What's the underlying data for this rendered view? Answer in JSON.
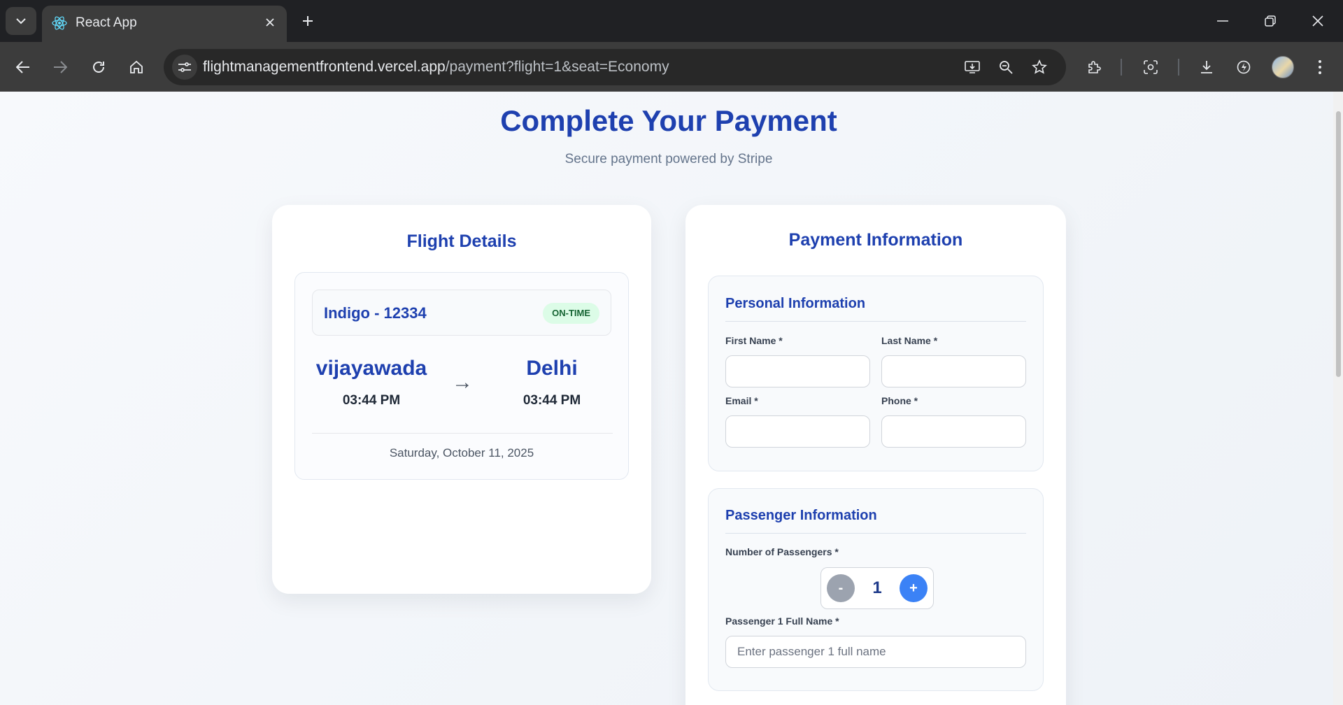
{
  "browser": {
    "tab_title": "React App",
    "url_host": "flightmanagementfrontend.vercel.app",
    "url_path": "/payment?flight=1&seat=Economy"
  },
  "page": {
    "title": "Complete Your Payment",
    "subtitle": "Secure payment powered by Stripe"
  },
  "flight_details": {
    "heading": "Flight Details",
    "airline": "Indigo - 12334",
    "status": "ON-TIME",
    "origin": {
      "city": "vijayawada",
      "time": "03:44 PM"
    },
    "destination": {
      "city": "Delhi",
      "time": "03:44 PM"
    },
    "arrow": "→",
    "date": "Saturday, October 11, 2025"
  },
  "payment": {
    "heading": "Payment Information",
    "personal": {
      "title": "Personal Information",
      "first_name_label": "First Name *",
      "last_name_label": "Last Name *",
      "email_label": "Email *",
      "phone_label": "Phone *",
      "first_name_value": "",
      "last_name_value": "",
      "email_value": "",
      "phone_value": ""
    },
    "passenger": {
      "title": "Passenger Information",
      "count_label": "Number of Passengers *",
      "minus": "-",
      "count": "1",
      "plus": "+",
      "name_label": "Passenger 1 Full Name *",
      "name_placeholder": "Enter passenger 1 full name"
    }
  },
  "colors": {
    "accent": "#1e40af",
    "status_bg": "#dcfce7",
    "status_text": "#166534",
    "plus_button": "#3b82f6",
    "minus_button": "#9ca3af"
  },
  "icons": [
    "tab-list-icon",
    "react-logo-icon",
    "close-icon",
    "plus-icon",
    "minimize-icon",
    "restore-icon",
    "back-icon",
    "forward-icon",
    "reload-icon",
    "home-icon",
    "site-info-icon",
    "install-app-icon",
    "zoom-icon",
    "star-icon",
    "extensions-icon",
    "lens-icon",
    "download-icon",
    "performance-icon",
    "menu-icon"
  ]
}
